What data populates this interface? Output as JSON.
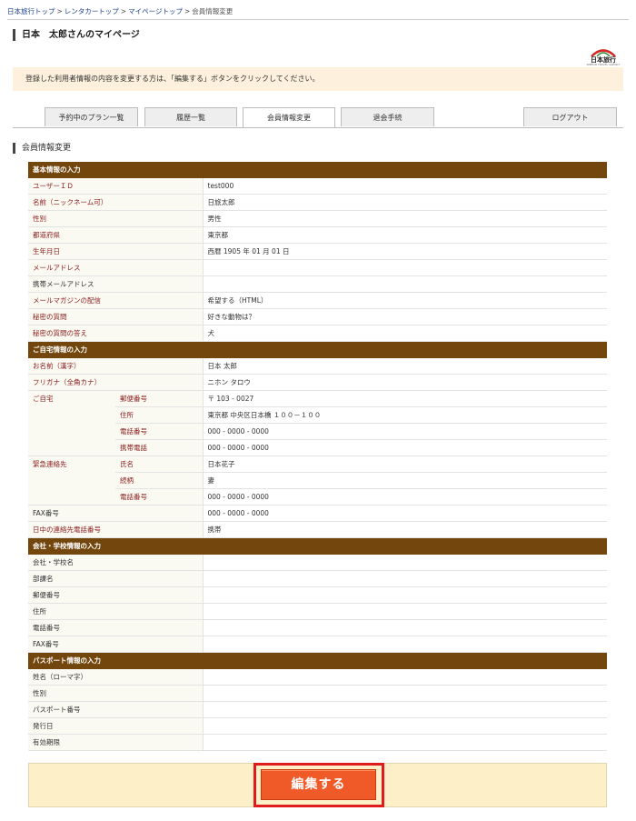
{
  "breadcrumb": {
    "items": [
      "日本旅行トップ",
      "レンタカートップ",
      "マイページトップ",
      "会員情報変更"
    ],
    "sep": ">"
  },
  "page_title": "日本　太郎さんのマイページ",
  "logo": {
    "text": "日本旅行",
    "sub": "NIPPON TRAVEL AGENCY"
  },
  "notice": "登録した利用者情報の内容を変更する方は、「編集する」ボタンをクリックしてください。",
  "tabs": [
    {
      "label": "予約中のプラン一覧"
    },
    {
      "label": "履歴一覧"
    },
    {
      "label": "会員情報変更"
    },
    {
      "label": "退会手続"
    },
    {
      "label": "ログアウト"
    }
  ],
  "section_title": "会員情報変更",
  "basic": {
    "header": "基本情報の入力",
    "rows": [
      {
        "label": "ユーザーＩＤ",
        "value": "test000"
      },
      {
        "label": "名前（ニックネーム可）",
        "value": "日旅太郎"
      },
      {
        "label": "性別",
        "value": "男性"
      },
      {
        "label": "都道府県",
        "value": "東京都"
      },
      {
        "label": "生年月日",
        "value": "西暦 1905 年 01 月 01 日"
      },
      {
        "label": "メールアドレス",
        "value": ""
      },
      {
        "label": "携帯メールアドレス",
        "value": ""
      },
      {
        "label": "メールマガジンの配信",
        "value": "希望する（HTML）"
      },
      {
        "label": "秘密の質問",
        "value": "好きな動物は？"
      },
      {
        "label": "秘密の質問の答え",
        "value": "犬"
      }
    ]
  },
  "home": {
    "header": "ご自宅情報の入力",
    "name_kanji": {
      "label": "お名前（漢字）",
      "value": "日本 太郎"
    },
    "name_kana": {
      "label": "フリガナ（全角カナ）",
      "value": "ニホン タロウ"
    },
    "address": {
      "label": "ご自宅",
      "rows": [
        {
          "label": "郵便番号",
          "value": "〒 103 - 0027"
        },
        {
          "label": "住所",
          "value": "東京都 中央区日本橋 １００－１００"
        },
        {
          "label": "電話番号",
          "value": "000 - 0000 - 0000"
        },
        {
          "label": "携帯電話",
          "value": "000 - 0000 - 0000"
        }
      ]
    },
    "emergency": {
      "label": "緊急連絡先",
      "rows": [
        {
          "label": "氏名",
          "value": "日本花子"
        },
        {
          "label": "続柄",
          "value": "妻"
        },
        {
          "label": "電話番号",
          "value": "000 - 0000 - 0000"
        }
      ]
    },
    "fax": {
      "label": "FAX番号",
      "value": "000 - 0000 - 0000"
    },
    "daytime": {
      "label": "日中の連絡先電話番号",
      "value": "携帯"
    }
  },
  "company": {
    "header": "会社・学校情報の入力",
    "rows": [
      {
        "label": "会社・学校名",
        "value": ""
      },
      {
        "label": "部課名",
        "value": ""
      },
      {
        "label": "郵便番号",
        "value": ""
      },
      {
        "label": "住所",
        "value": ""
      },
      {
        "label": "電話番号",
        "value": ""
      },
      {
        "label": "FAX番号",
        "value": ""
      }
    ]
  },
  "passport": {
    "header": "パスポート情報の入力",
    "rows": [
      {
        "label": "姓名（ローマ字）",
        "value": ""
      },
      {
        "label": "性別",
        "value": ""
      },
      {
        "label": "パスポート番号",
        "value": ""
      },
      {
        "label": "発行日",
        "value": ""
      },
      {
        "label": "有効期限",
        "value": ""
      }
    ]
  },
  "edit_button": "編集する",
  "colors": {
    "header_bg": "#72460c",
    "label_red": "#8b1a1a",
    "button_bg": "#f05a28",
    "highlight": "#e01b1b"
  }
}
